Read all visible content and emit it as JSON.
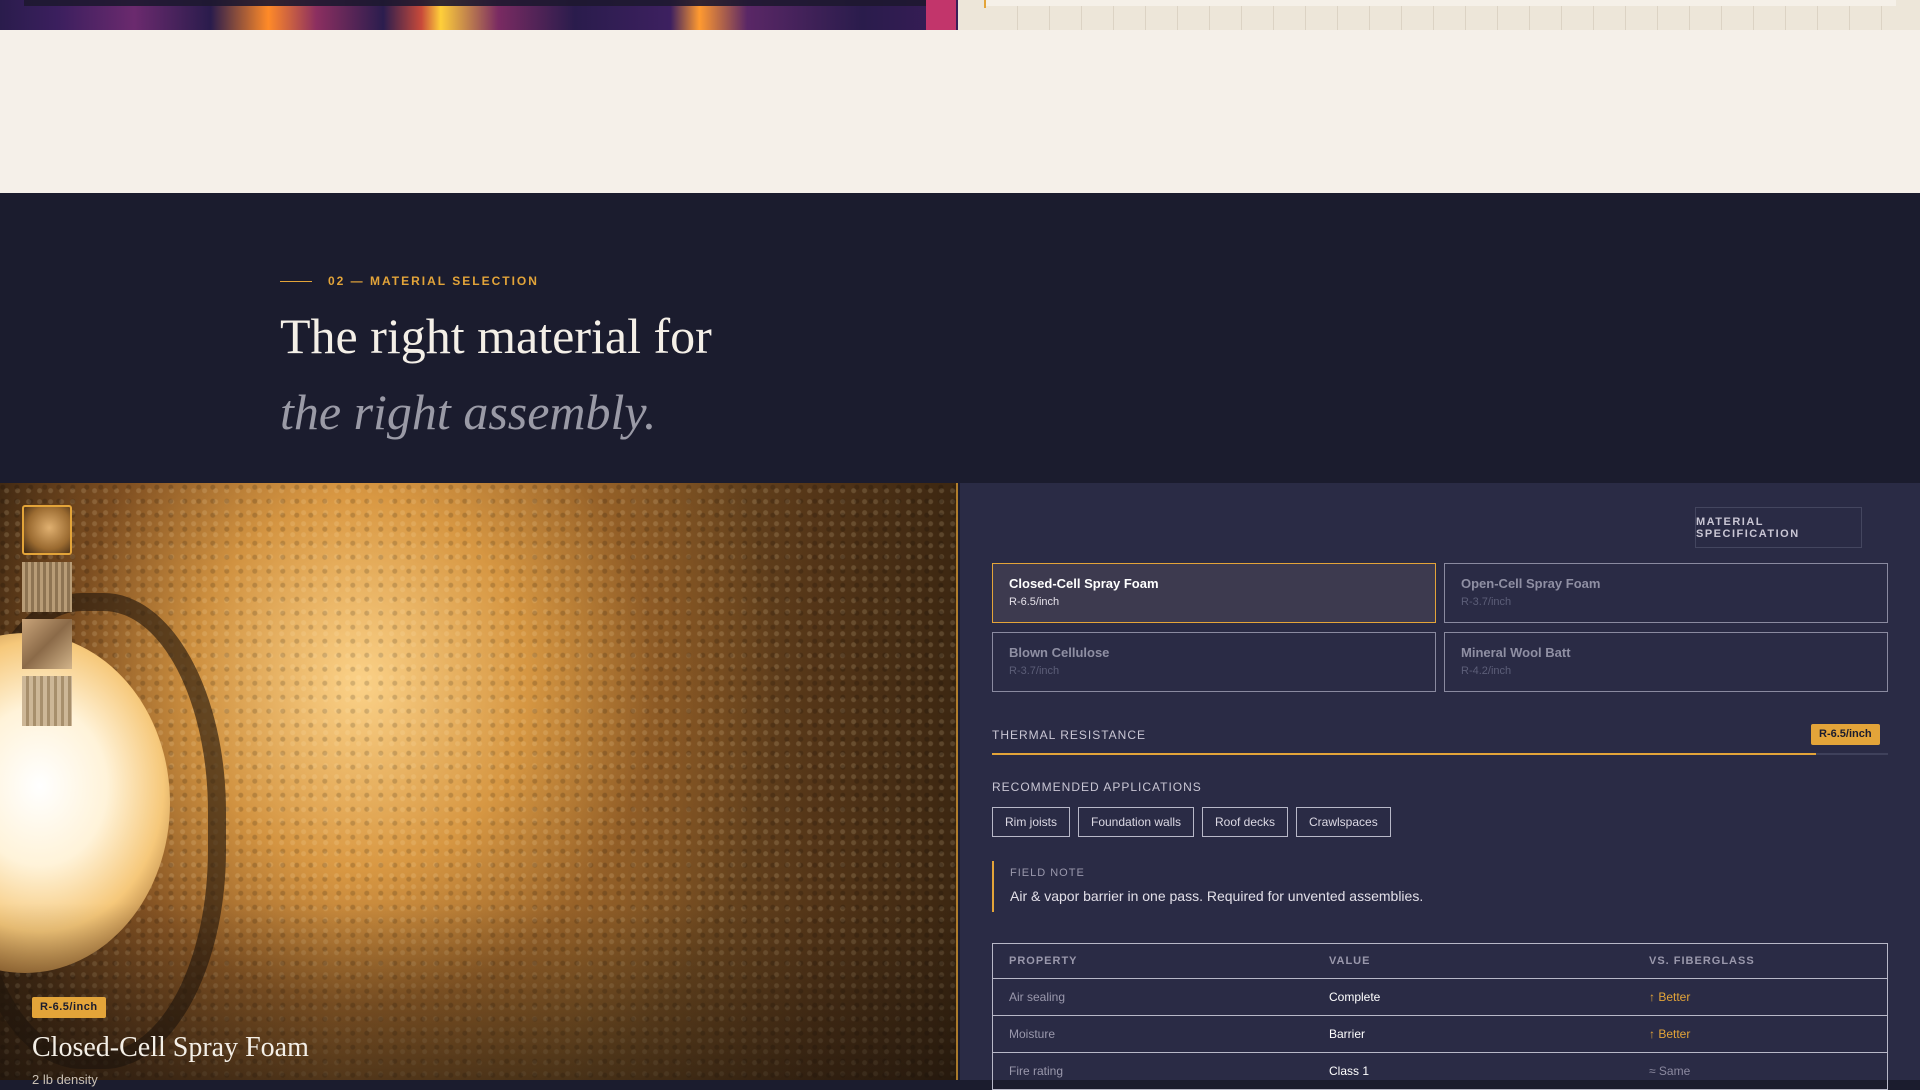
{
  "heading": {
    "eyebrow": "02 — MATERIAL SELECTION",
    "line1": "The right material for",
    "line2": "the right assembly."
  },
  "photo": {
    "badge": "R-6.5/inch",
    "title": "Closed-Cell Spray Foam",
    "subtitle": "2 lb density"
  },
  "spec": {
    "label": "MATERIAL SPECIFICATION",
    "materials": [
      {
        "name": "Closed-Cell Spray Foam",
        "r_value": "R-6.5/inch",
        "active": true
      },
      {
        "name": "Open-Cell Spray Foam",
        "r_value": "R-3.7/inch",
        "active": false
      },
      {
        "name": "Blown Cellulose",
        "r_value": "R-3.7/inch",
        "active": false
      },
      {
        "name": "Mineral Wool Batt",
        "r_value": "R-4.2/inch",
        "active": false
      }
    ],
    "thermal": {
      "label": "THERMAL RESISTANCE",
      "badge": "R-6.5/inch",
      "fill_fraction": 0.92
    },
    "applications": {
      "label": "RECOMMENDED APPLICATIONS",
      "tags": [
        "Rim joists",
        "Foundation walls",
        "Roof decks",
        "Crawlspaces"
      ]
    },
    "note": {
      "label": "FIELD NOTE",
      "text": "Air & vapor barrier in one pass. Required for unvented assemblies."
    },
    "table": {
      "headers": [
        "PROPERTY",
        "VALUE",
        "VS. FIBERGLASS"
      ],
      "rows": [
        {
          "property": "Air sealing",
          "value": "Complete",
          "comparison": "↑ Better"
        },
        {
          "property": "Moisture",
          "value": "Barrier",
          "comparison": "↑ Better"
        },
        {
          "property": "Fire rating",
          "value": "Class 1",
          "comparison": "≈ Same"
        }
      ]
    }
  },
  "colors": {
    "accent": "#e3a439",
    "navy": "#1b1c2e",
    "panel": "#2a2b45",
    "cream": "#f5f0e9"
  },
  "icons": {
    "thumbnails": [
      "spray-foam-thumbnail",
      "wood-batt-thumbnail",
      "cellulose-thumbnail",
      "mineral-wool-thumbnail"
    ]
  }
}
